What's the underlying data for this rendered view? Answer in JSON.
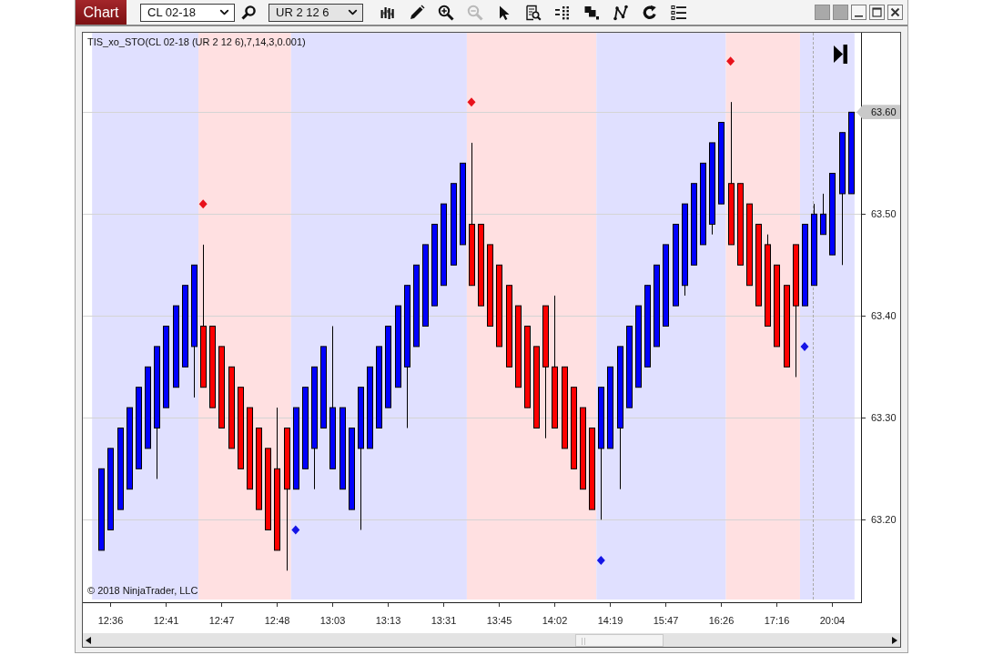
{
  "window": {
    "title": "Chart"
  },
  "toolbar": {
    "selectors": [
      {
        "kind": "instrument",
        "value": "CL 02-18"
      },
      {
        "kind": "bar_type",
        "value": "UR 2 12 6"
      }
    ],
    "tools": [
      {
        "kind": "bar_style",
        "disabled": false
      },
      {
        "kind": "draw",
        "disabled": false
      },
      {
        "kind": "zoom_in",
        "disabled": false
      },
      {
        "kind": "zoom_out",
        "disabled": true
      },
      {
        "kind": "pointer",
        "disabled": false
      },
      {
        "kind": "data_box",
        "disabled": false
      },
      {
        "kind": "indicators",
        "disabled": false
      },
      {
        "kind": "strategies",
        "disabled": false
      },
      {
        "kind": "drawing_tools",
        "disabled": false
      },
      {
        "kind": "reload",
        "disabled": false
      },
      {
        "kind": "properties",
        "disabled": false
      }
    ]
  },
  "chart": {
    "indicator_label": "TIS_xo_STO(CL 02-18 (UR 2 12 6),7,14,3,0.001)",
    "copyright": "© 2018 NinjaTrader, LLC",
    "chart_data": {
      "type": "candlestick",
      "ylim": [
        63.119,
        63.678
      ],
      "grid": true,
      "categories": [
        null,
        "12:36",
        null,
        null,
        null,
        null,
        null,
        "12:41",
        null,
        null,
        null,
        null,
        null,
        "12:47",
        null,
        null,
        null,
        null,
        null,
        "12:48",
        null,
        null,
        null,
        null,
        null,
        "13:03",
        null,
        null,
        null,
        null,
        null,
        "13:13",
        null,
        null,
        null,
        null,
        null,
        "13:31",
        null,
        null,
        null,
        null,
        null,
        "13:45",
        null,
        null,
        null,
        null,
        null,
        "14:02",
        null,
        null,
        null,
        null,
        null,
        "14:19",
        null,
        null,
        null,
        null,
        null,
        "15:47",
        null,
        null,
        null,
        null,
        null,
        "16:26",
        null,
        null,
        null,
        null,
        null,
        "17:16",
        null,
        null,
        null,
        null,
        null,
        "20:04",
        null,
        null
      ],
      "ohlc": [
        [
          63.17,
          63.25,
          63.17,
          63.25
        ],
        [
          63.19,
          63.27,
          63.19,
          63.27
        ],
        [
          63.21,
          63.29,
          63.21,
          63.29
        ],
        [
          63.23,
          63.31,
          63.23,
          63.31
        ],
        [
          63.25,
          63.33,
          63.25,
          63.33
        ],
        [
          63.27,
          63.35,
          63.27,
          63.35
        ],
        [
          63.29,
          63.37,
          63.24,
          63.37
        ],
        [
          63.31,
          63.39,
          63.31,
          63.39
        ],
        [
          63.33,
          63.41,
          63.33,
          63.41
        ],
        [
          63.35,
          63.43,
          63.35,
          63.43
        ],
        [
          63.37,
          63.45,
          63.32,
          63.45
        ],
        [
          63.39,
          63.47,
          63.33,
          63.33
        ],
        [
          63.39,
          63.39,
          63.31,
          63.31
        ],
        [
          63.37,
          63.37,
          63.29,
          63.29
        ],
        [
          63.35,
          63.35,
          63.27,
          63.27
        ],
        [
          63.33,
          63.33,
          63.25,
          63.25
        ],
        [
          63.31,
          63.31,
          63.23,
          63.23
        ],
        [
          63.29,
          63.29,
          63.21,
          63.21
        ],
        [
          63.27,
          63.27,
          63.19,
          63.19
        ],
        [
          63.25,
          63.31,
          63.17,
          63.17
        ],
        [
          63.29,
          63.29,
          63.15,
          63.23
        ],
        [
          63.23,
          63.31,
          63.23,
          63.31
        ],
        [
          63.25,
          63.33,
          63.25,
          63.33
        ],
        [
          63.27,
          63.35,
          63.23,
          63.35
        ],
        [
          63.29,
          63.37,
          63.29,
          63.37
        ],
        [
          63.25,
          63.39,
          63.25,
          63.31
        ],
        [
          63.23,
          63.31,
          63.23,
          63.31
        ],
        [
          63.21,
          63.29,
          63.21,
          63.29
        ],
        [
          63.27,
          63.33,
          63.19,
          63.33
        ],
        [
          63.27,
          63.35,
          63.27,
          63.35
        ],
        [
          63.29,
          63.37,
          63.29,
          63.37
        ],
        [
          63.31,
          63.39,
          63.31,
          63.39
        ],
        [
          63.33,
          63.41,
          63.33,
          63.41
        ],
        [
          63.35,
          63.43,
          63.29,
          63.43
        ],
        [
          63.37,
          63.45,
          63.37,
          63.45
        ],
        [
          63.39,
          63.47,
          63.39,
          63.47
        ],
        [
          63.41,
          63.49,
          63.41,
          63.49
        ],
        [
          63.43,
          63.51,
          63.43,
          63.51
        ],
        [
          63.45,
          63.53,
          63.45,
          63.53
        ],
        [
          63.47,
          63.55,
          63.47,
          63.55
        ],
        [
          63.49,
          63.57,
          63.43,
          63.43
        ],
        [
          63.49,
          63.49,
          63.41,
          63.41
        ],
        [
          63.47,
          63.47,
          63.39,
          63.39
        ],
        [
          63.45,
          63.45,
          63.37,
          63.37
        ],
        [
          63.43,
          63.43,
          63.35,
          63.35
        ],
        [
          63.41,
          63.41,
          63.33,
          63.33
        ],
        [
          63.39,
          63.39,
          63.31,
          63.31
        ],
        [
          63.37,
          63.37,
          63.29,
          63.29
        ],
        [
          63.41,
          63.41,
          63.28,
          63.35
        ],
        [
          63.35,
          63.42,
          63.29,
          63.29
        ],
        [
          63.35,
          63.35,
          63.27,
          63.27
        ],
        [
          63.33,
          63.33,
          63.25,
          63.25
        ],
        [
          63.31,
          63.31,
          63.23,
          63.23
        ],
        [
          63.29,
          63.29,
          63.21,
          63.21
        ],
        [
          63.27,
          63.33,
          63.2,
          63.33
        ],
        [
          63.27,
          63.35,
          63.27,
          63.35
        ],
        [
          63.29,
          63.37,
          63.23,
          63.37
        ],
        [
          63.31,
          63.39,
          63.31,
          63.39
        ],
        [
          63.33,
          63.41,
          63.33,
          63.41
        ],
        [
          63.35,
          63.43,
          63.35,
          63.43
        ],
        [
          63.37,
          63.45,
          63.37,
          63.45
        ],
        [
          63.39,
          63.47,
          63.39,
          63.47
        ],
        [
          63.41,
          63.49,
          63.41,
          63.49
        ],
        [
          63.43,
          63.51,
          63.42,
          63.51
        ],
        [
          63.45,
          63.53,
          63.45,
          63.53
        ],
        [
          63.47,
          63.55,
          63.47,
          63.55
        ],
        [
          63.49,
          63.57,
          63.48,
          63.57
        ],
        [
          63.51,
          63.59,
          63.51,
          63.59
        ],
        [
          63.53,
          63.61,
          63.47,
          63.47
        ],
        [
          63.53,
          63.53,
          63.45,
          63.45
        ],
        [
          63.51,
          63.51,
          63.43,
          63.43
        ],
        [
          63.49,
          63.49,
          63.41,
          63.41
        ],
        [
          63.47,
          63.48,
          63.39,
          63.39
        ],
        [
          63.45,
          63.45,
          63.37,
          63.37
        ],
        [
          63.43,
          63.43,
          63.35,
          63.35
        ],
        [
          63.47,
          63.47,
          63.34,
          63.41
        ],
        [
          63.41,
          63.49,
          63.41,
          63.49
        ],
        [
          63.43,
          63.51,
          63.43,
          63.5
        ],
        [
          63.48,
          63.52,
          63.48,
          63.5
        ],
        [
          63.46,
          63.54,
          63.46,
          63.54
        ],
        [
          63.52,
          63.58,
          63.45,
          63.58
        ],
        [
          63.52,
          63.6,
          63.52,
          63.6
        ]
      ],
      "yticks": [
        {
          "value": 63.6,
          "label": "63.60"
        },
        {
          "value": 63.5,
          "label": "63.50"
        },
        {
          "value": 63.4,
          "label": "63.40"
        },
        {
          "value": 63.3,
          "label": "63.30"
        },
        {
          "value": 63.2,
          "label": "63.20"
        }
      ]
    }
  }
}
